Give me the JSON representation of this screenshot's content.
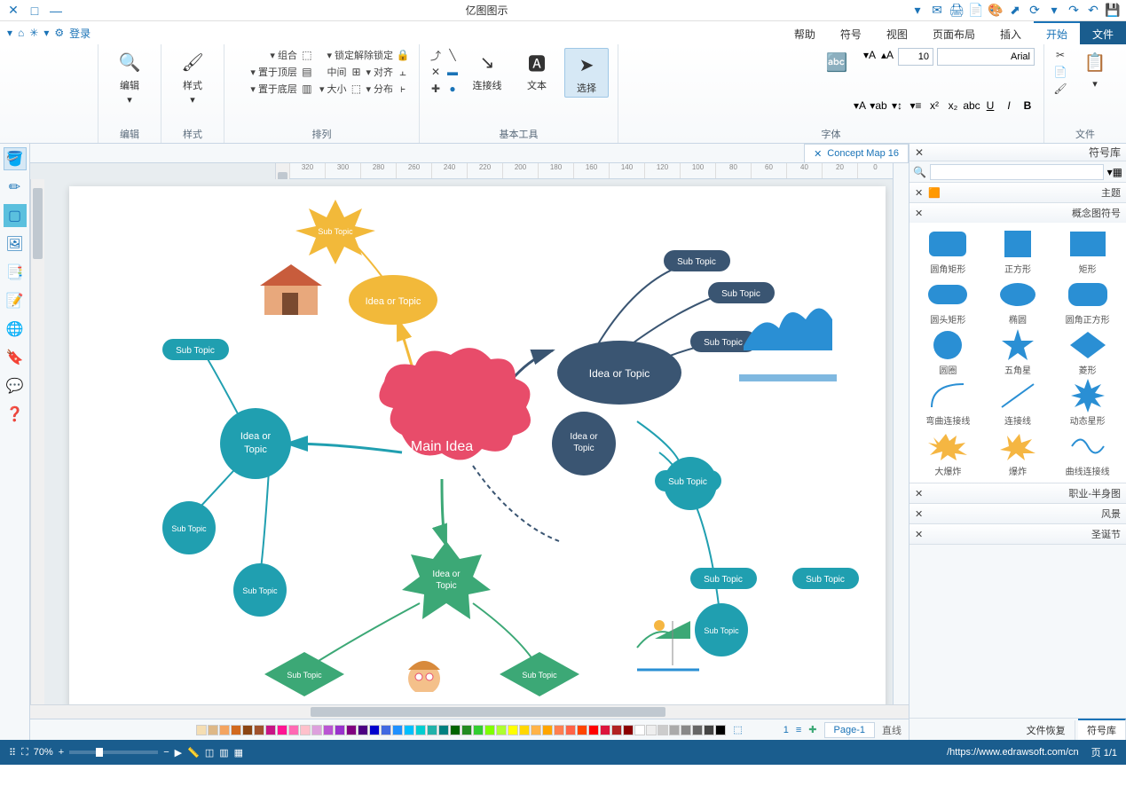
{
  "window": {
    "title": "亿图图示"
  },
  "quick_tools": [
    "save-icon",
    "undo-icon",
    "redo-icon",
    "print-icon",
    "export-icon",
    "share-icon",
    "theme-icon"
  ],
  "menu": {
    "file": "文件",
    "tabs": [
      "开始",
      "插入",
      "页面布局",
      "视图",
      "符号",
      "帮助"
    ],
    "active_index": 0,
    "login": "登录"
  },
  "ribbon": {
    "group_file": {
      "title": "文件"
    },
    "group_font": {
      "title": "字体",
      "font_name": "Arial",
      "font_size": "10"
    },
    "group_tools": {
      "title": "基本工具",
      "items": [
        "选择",
        "文本",
        "连接线",
        "线条"
      ]
    },
    "group_arrange": {
      "title": "排列",
      "items": [
        "锁定解除锁定",
        "对齐",
        "分布",
        "大小",
        "中间",
        "组合",
        "置于顶层",
        "置于底层"
      ]
    },
    "group_style": {
      "title": "样式",
      "label": "样式"
    },
    "group_edit": {
      "title": "编辑",
      "label": "编辑"
    }
  },
  "side_panel": {
    "header": "符号库",
    "sections": {
      "topic": "主题",
      "concept_shapes": "概念图符号",
      "career": "职业-半身图",
      "scenery": "风景",
      "holiday": "圣诞节"
    },
    "shapes": [
      {
        "name": "矩形"
      },
      {
        "name": "正方形"
      },
      {
        "name": "圆角矩形"
      },
      {
        "name": "圆角正方形"
      },
      {
        "name": "椭圆"
      },
      {
        "name": "圆头矩形"
      },
      {
        "name": "菱形"
      },
      {
        "name": "五角星"
      },
      {
        "name": "圆圈"
      },
      {
        "name": "动态星形"
      },
      {
        "name": "连接线"
      },
      {
        "name": "弯曲连接线"
      },
      {
        "name": "曲线连接线"
      },
      {
        "name": "爆炸"
      },
      {
        "name": "大爆炸"
      }
    ],
    "bottom_tabs": [
      "符号库",
      "文件恢复"
    ]
  },
  "doc_tab": {
    "name": "Concept Map 16"
  },
  "page_tab": {
    "name": "Page-1",
    "count": "1"
  },
  "mindmap": {
    "main": "Main Idea",
    "ideas": [
      "Idea or Topic",
      "Idea or Topic",
      "Idea or Topic",
      "Idea or Topic"
    ],
    "subs": [
      "Sub Topic",
      "Sub Topic",
      "Sub Topic",
      "Sub Topic",
      "Sub Topic",
      "Sub Topic",
      "Sub Topic",
      "Sub Topic",
      "Sub Topic",
      "Sub Topic",
      "Sub Topic",
      "Sub Topic",
      "Sub Topic"
    ]
  },
  "ruler_marks": [
    "0",
    "20",
    "40",
    "60",
    "80",
    "100",
    "120",
    "140",
    "160",
    "180",
    "200",
    "220",
    "240",
    "260",
    "280",
    "300",
    "320"
  ],
  "status": {
    "url": "https://www.edrawsoft.com/cn/",
    "page_info": "页 1/1",
    "zoom": "70%"
  },
  "palette": [
    "#000000",
    "#444444",
    "#666666",
    "#888888",
    "#aaaaaa",
    "#cccccc",
    "#eeeeee",
    "#ffffff",
    "#8b0000",
    "#b22222",
    "#dc143c",
    "#ff0000",
    "#ff4500",
    "#ff6347",
    "#ff7f50",
    "#ffa500",
    "#ffb347",
    "#ffd700",
    "#ffff00",
    "#adff2f",
    "#7fff00",
    "#32cd32",
    "#228b22",
    "#006400",
    "#008080",
    "#20b2aa",
    "#00ced1",
    "#00bfff",
    "#1e90ff",
    "#4169e1",
    "#0000cd",
    "#4b0082",
    "#800080",
    "#9932cc",
    "#ba55d3",
    "#dda0dd",
    "#ffc0cb",
    "#ff69b4",
    "#ff1493",
    "#c71585",
    "#a0522d",
    "#8b4513",
    "#d2691e",
    "#f4a460",
    "#deb887",
    "#f5deb3"
  ]
}
